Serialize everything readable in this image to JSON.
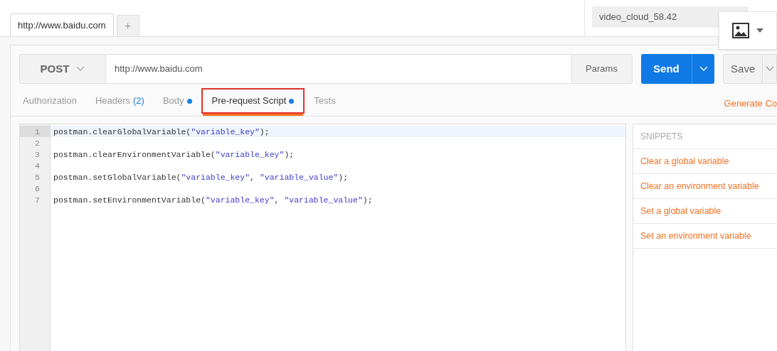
{
  "request_tabs": [
    {
      "label": "http://www.baidu.com",
      "selected": true
    }
  ],
  "new_tab": "+",
  "environment": {
    "value": "video_cloud_58.42"
  },
  "request": {
    "method": "POST",
    "url": "http://www.baidu.com",
    "params": "Params",
    "send": "Send",
    "save": "Save"
  },
  "section_tabs": [
    {
      "label": "Authorization",
      "selected": false
    },
    {
      "label": "Headers",
      "count": "(2)",
      "selected": false
    },
    {
      "label": "Body",
      "dot": true,
      "selected": false
    },
    {
      "label": "Pre-request Script",
      "dot": true,
      "selected": true
    },
    {
      "label": "Tests",
      "selected": false
    }
  ],
  "generate_code": "Generate Co",
  "editor": {
    "lines": [
      {
        "number": "1",
        "current": true,
        "segments": [
          {
            "kind": "plain",
            "text": "postman.clearGlobalVariable("
          },
          {
            "kind": "string",
            "text": "\"variable_key\""
          },
          {
            "kind": "plain",
            "text": ");"
          }
        ]
      },
      {
        "number": "2",
        "current": false
      },
      {
        "number": "3",
        "current": false,
        "segments": [
          {
            "kind": "plain",
            "text": "postman.clearEnvironmentVariable("
          },
          {
            "kind": "string",
            "text": "\"variable_key\""
          },
          {
            "kind": "plain",
            "text": ");"
          }
        ]
      },
      {
        "number": "4",
        "current": false
      },
      {
        "number": "5",
        "current": false,
        "segments": [
          {
            "kind": "plain",
            "text": "postman.setGlobalVariable("
          },
          {
            "kind": "string",
            "text": "\"variable_key\""
          },
          {
            "kind": "plain",
            "text": ", "
          },
          {
            "kind": "string",
            "text": "\"variable_value\""
          },
          {
            "kind": "plain",
            "text": ");"
          }
        ]
      },
      {
        "number": "6",
        "current": false
      },
      {
        "number": "7",
        "current": false,
        "segments": [
          {
            "kind": "plain",
            "text": "postman.setEnvironmentVariable("
          },
          {
            "kind": "string",
            "text": "\"variable_key\""
          },
          {
            "kind": "plain",
            "text": ", "
          },
          {
            "kind": "string",
            "text": "\"variable_value\""
          },
          {
            "kind": "plain",
            "text": ");"
          }
        ]
      }
    ]
  },
  "snippets": {
    "title": "SNIPPETS",
    "items": [
      "Clear a global variable",
      "Clear an environment variable",
      "Set a global variable",
      "Set an environment variable"
    ]
  }
}
